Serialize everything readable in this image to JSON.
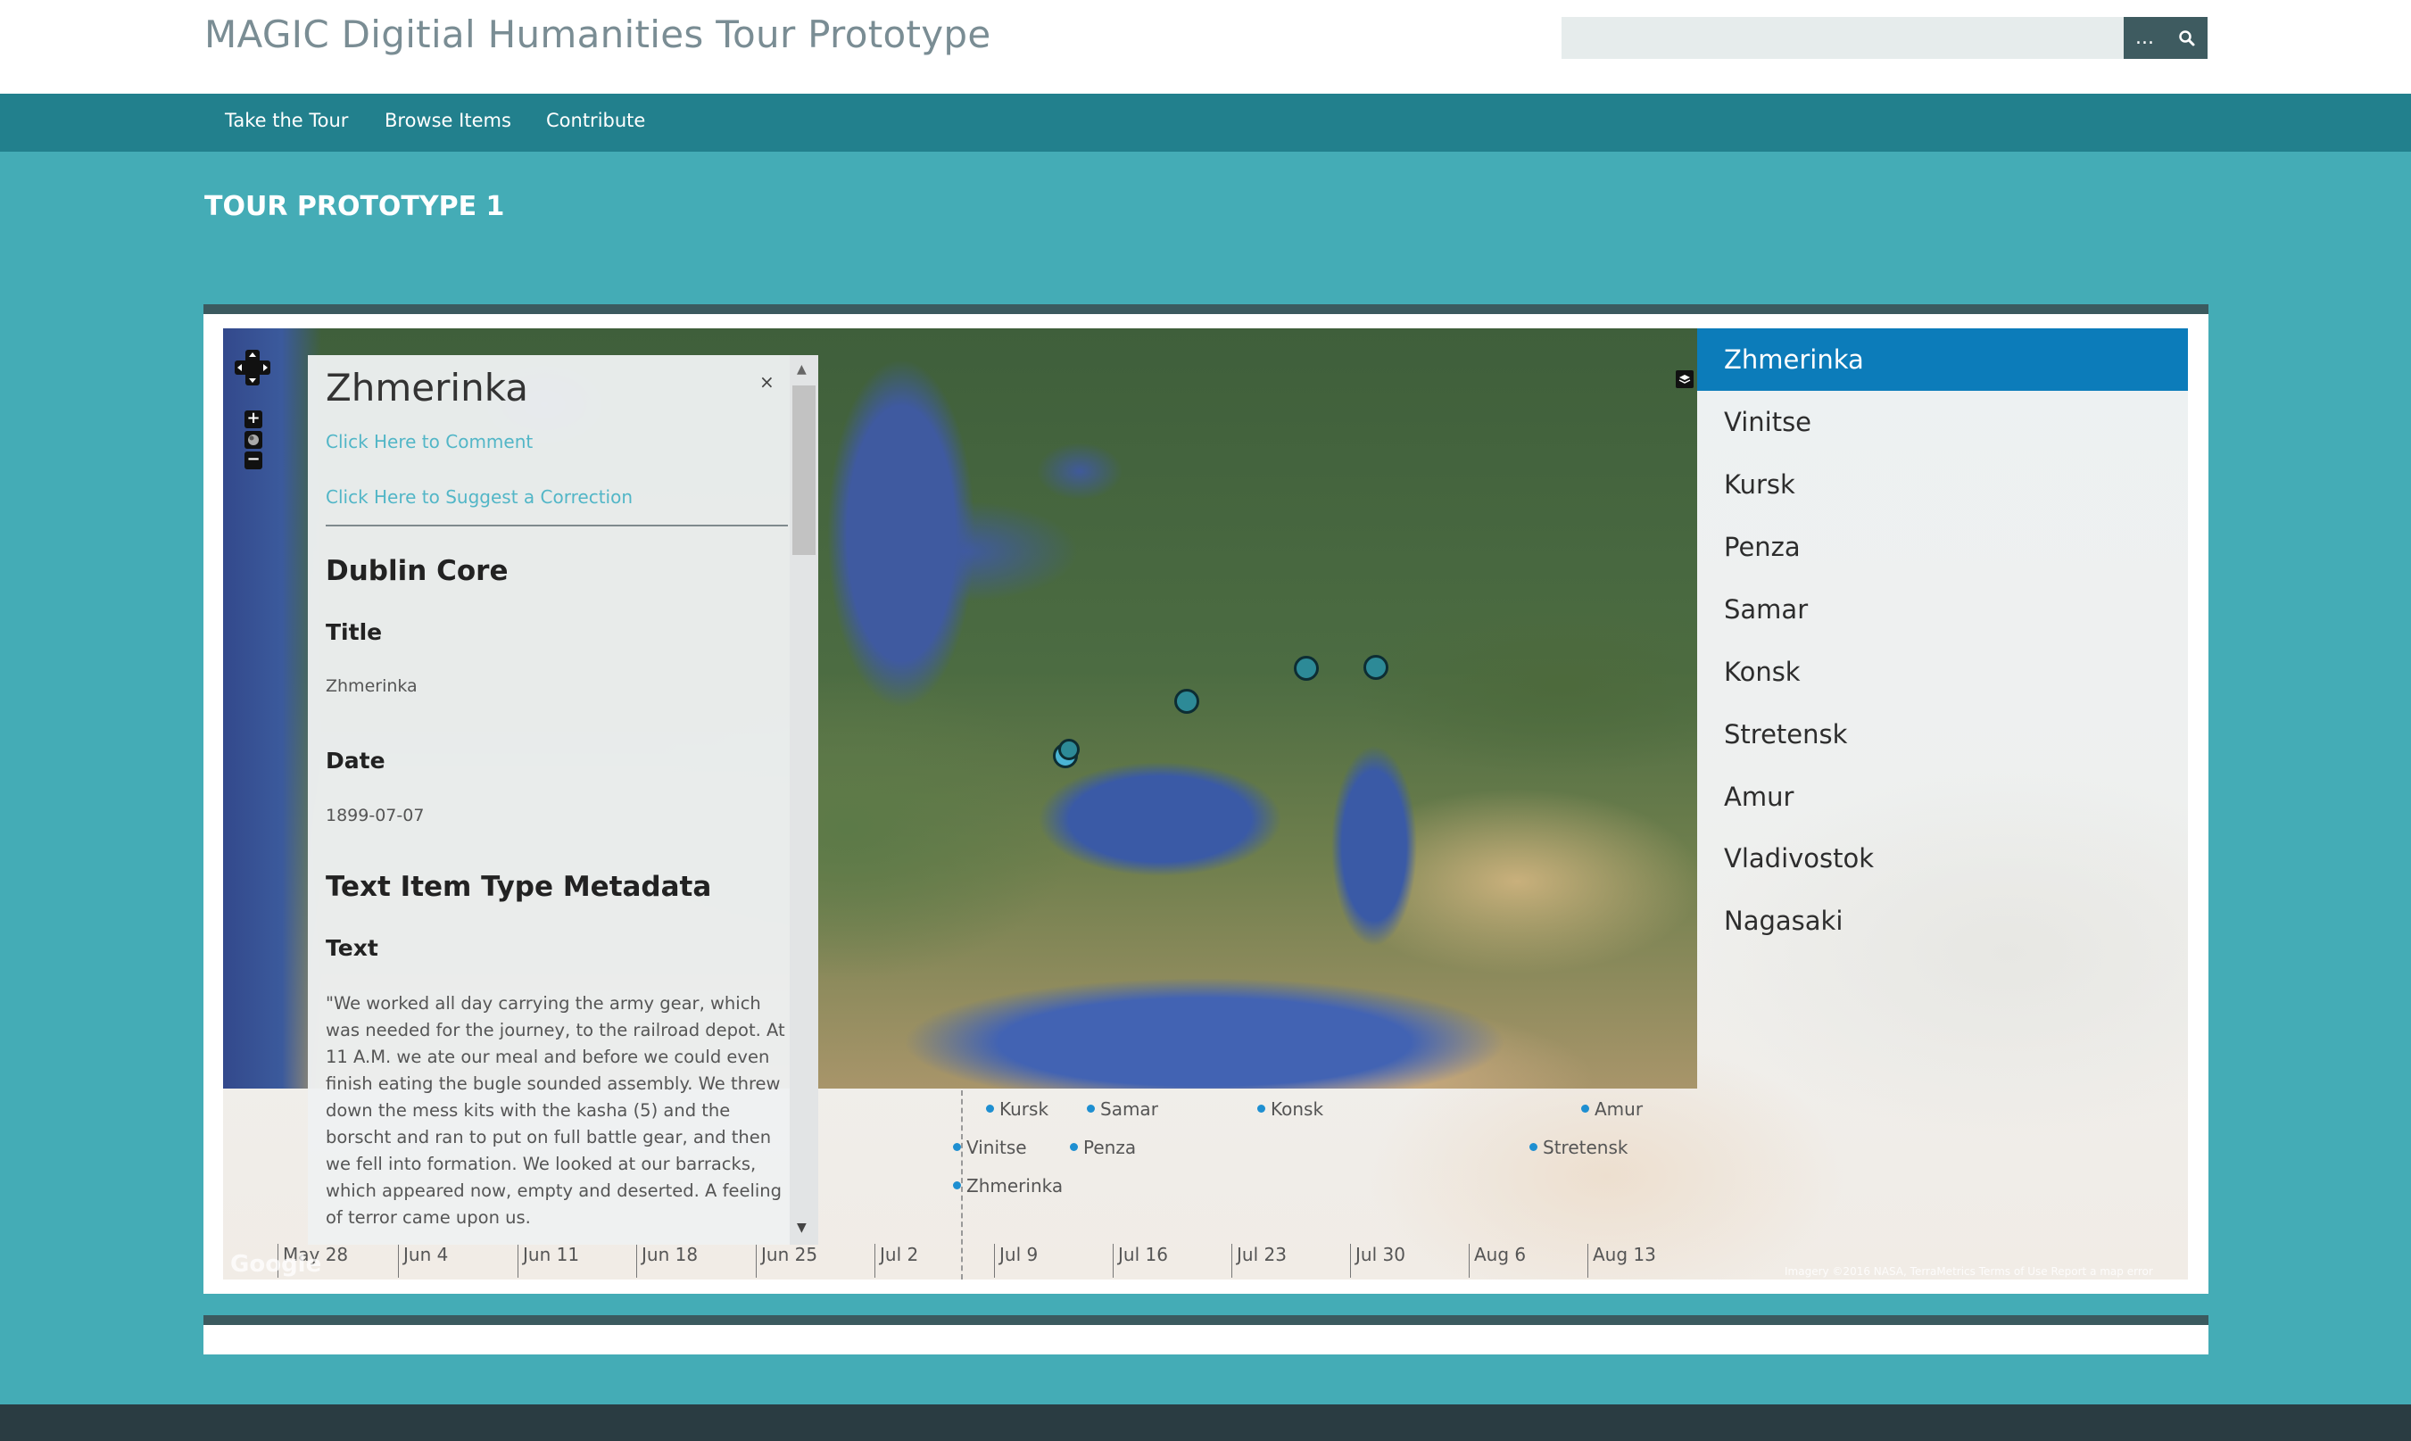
{
  "header": {
    "site_title": "MAGIC Digitial Humanities Tour Prototype",
    "search_placeholder": "",
    "search_options_label": "...",
    "search_icon": "search-icon"
  },
  "nav": {
    "items": [
      {
        "label": "Take the Tour"
      },
      {
        "label": "Browse Items"
      },
      {
        "label": "Contribute"
      }
    ]
  },
  "page": {
    "title": "TOUR PROTOTYPE 1"
  },
  "map": {
    "controls": {
      "zoom_in": "+",
      "zoom_out": "−"
    },
    "layers_icon": "layers-icon"
  },
  "popup": {
    "title": "Zhmerinka",
    "close_label": "×",
    "comment_link": "Click Here to Comment",
    "correction_link": "Click Here to Suggest a Correction",
    "section_dublin_core": "Dublin Core",
    "field_title_label": "Title",
    "field_title_value": "Zhmerinka",
    "field_date_label": "Date",
    "field_date_value": "1899-07-07",
    "section_item_type": "Text Item Type Metadata",
    "field_text_label": "Text",
    "field_text_value": "\"We worked all day carrying the army gear, which was needed for the journey, to the railroad depot. At 11 A.M. we ate our meal and before we could even finish eating the bugle sounded assembly. We threw down the mess kits with the kasha (5) and the borscht and ran to put on full battle gear, and then we fell into formation. We looked at our barracks, which appeared now, empty and deserted. A feeling of terror came upon us."
  },
  "stops": [
    {
      "label": "Zhmerinka",
      "active": true
    },
    {
      "label": "Vinitse"
    },
    {
      "label": "Kursk"
    },
    {
      "label": "Penza"
    },
    {
      "label": "Samar"
    },
    {
      "label": "Konsk"
    },
    {
      "label": "Stretensk"
    },
    {
      "label": "Amur"
    },
    {
      "label": "Vladivostok"
    },
    {
      "label": "Nagasaki"
    }
  ],
  "timeline": {
    "events": [
      {
        "label": "Kursk"
      },
      {
        "label": "Samar"
      },
      {
        "label": "Konsk"
      },
      {
        "label": "Amur"
      },
      {
        "label": "Vinitse"
      },
      {
        "label": "Penza"
      },
      {
        "label": "Stretensk"
      },
      {
        "label": "Zhmerinka"
      }
    ],
    "ticks": [
      "May 28",
      "Jun 4",
      "Jun 11",
      "Jun 18",
      "Jun 25",
      "Jul 2",
      "Jul 9",
      "Jul 16",
      "Jul 23",
      "Jul 30",
      "Aug 6",
      "Aug 13"
    ]
  },
  "map_footer": {
    "google_logo": "Google",
    "attribution": "Imagery ©2016 NASA, TerraMetrics   Terms of Use   Report a map error"
  },
  "colors": {
    "page_bg": "#44acb6",
    "nav_bg": "#22808d",
    "active_item_bg": "#0c7cba",
    "panel_bar": "#3b5a5f",
    "link": "#52b6c7",
    "marker": "#2d8a97"
  }
}
